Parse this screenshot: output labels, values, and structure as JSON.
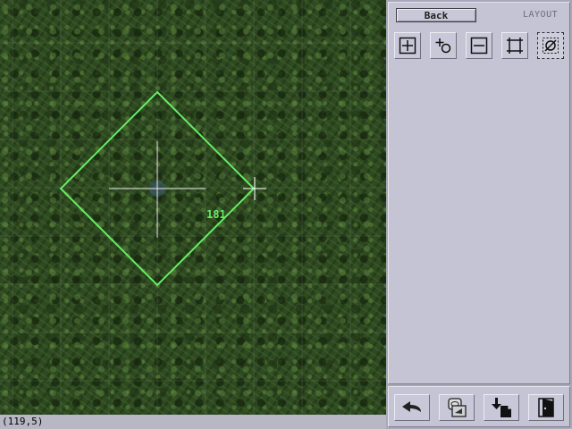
{
  "panel": {
    "back_label": "Back",
    "mode_label": "LAYOUT"
  },
  "tools": [
    {
      "name": "add-area-tool",
      "icon": "square-plus-icon"
    },
    {
      "name": "add-point-tool",
      "icon": "point-plus-icon"
    },
    {
      "name": "remove-area-tool",
      "icon": "square-minus-icon"
    },
    {
      "name": "resize-tool",
      "icon": "corners-icon"
    },
    {
      "name": "none-tool",
      "icon": "null-icon",
      "selected": true
    }
  ],
  "bottom_buttons": [
    {
      "name": "undo-button",
      "icon": "undo-arrow-icon"
    },
    {
      "name": "save-button",
      "icon": "disk-save-icon"
    },
    {
      "name": "import-button",
      "icon": "download-page-icon"
    },
    {
      "name": "exit-button",
      "icon": "door-exit-icon"
    }
  ],
  "map": {
    "selection_value": "181",
    "selection_color": "#66ee66"
  },
  "status": {
    "coords": "(119,5)"
  }
}
